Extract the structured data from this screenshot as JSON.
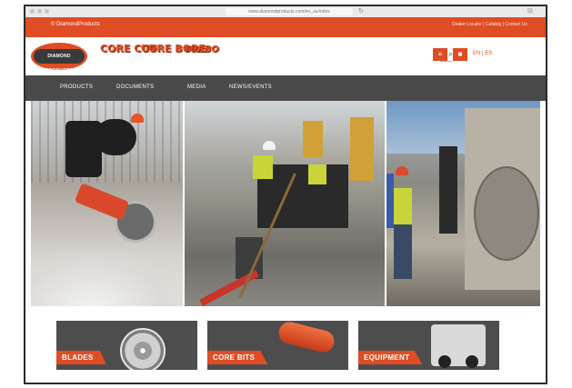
{
  "browser": {
    "url": "www.diamondproducts.com/en_us/index",
    "reload_glyph": "↻",
    "sidebar_glyph": "⊟"
  },
  "topbar": {
    "left_text": "© DiamondProducts",
    "right_text": "Dealer Locator  |  Catalog  |  Contact Us"
  },
  "header": {
    "logo_text": "DIAMOND PRODUCTS",
    "brand_core_cut": "CORE CUT",
    "brand_core_bore": "CORE BORE",
    "brand_turbo": "TURBO",
    "search_placeholder": "",
    "search_glyph": "⌕",
    "menu_glyph": "≡",
    "cart_glyph": "■",
    "language": "EN | ES"
  },
  "nav": {
    "items": [
      "PRODUCTS",
      "DOCUMENTS",
      "MEDIA",
      "NEWS/EVENTS"
    ]
  },
  "categories": [
    {
      "label": "BLADES"
    },
    {
      "label": "CORE BITS"
    },
    {
      "label": "EQUIPMENT"
    }
  ],
  "colors": {
    "accent": "#e04c23",
    "nav_bg": "#4a4a4a"
  }
}
